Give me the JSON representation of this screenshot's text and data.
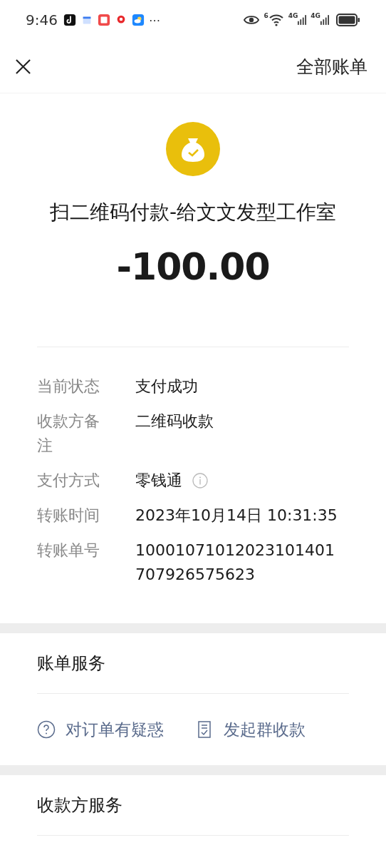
{
  "status_bar": {
    "time": "9:46",
    "more": "⋯",
    "wifi_label": "6",
    "network_labels": [
      "4G",
      "4G"
    ]
  },
  "nav": {
    "right_link": "全部账单"
  },
  "summary": {
    "title": "扫二维码付款-给文文发型工作室",
    "amount": "-100.00"
  },
  "details": [
    {
      "kind": "plain",
      "label": "当前状态",
      "value": "支付成功"
    },
    {
      "kind": "plain",
      "label": "收款方备注",
      "value": "二维码收款"
    },
    {
      "kind": "info",
      "label": "支付方式",
      "value": "零钱通"
    },
    {
      "kind": "plain",
      "label": "转账时间",
      "value": "2023年10月14日 10:31:35"
    },
    {
      "kind": "plain",
      "label": "转账单号",
      "value": "10001071012023101401707926575623"
    }
  ],
  "bill_services": {
    "title": "账单服务",
    "links": [
      {
        "kind": "question",
        "label": "对订单有疑惑"
      },
      {
        "kind": "receipt",
        "label": "发起群收款"
      }
    ]
  },
  "payee_services": {
    "title": "收款方服务"
  }
}
